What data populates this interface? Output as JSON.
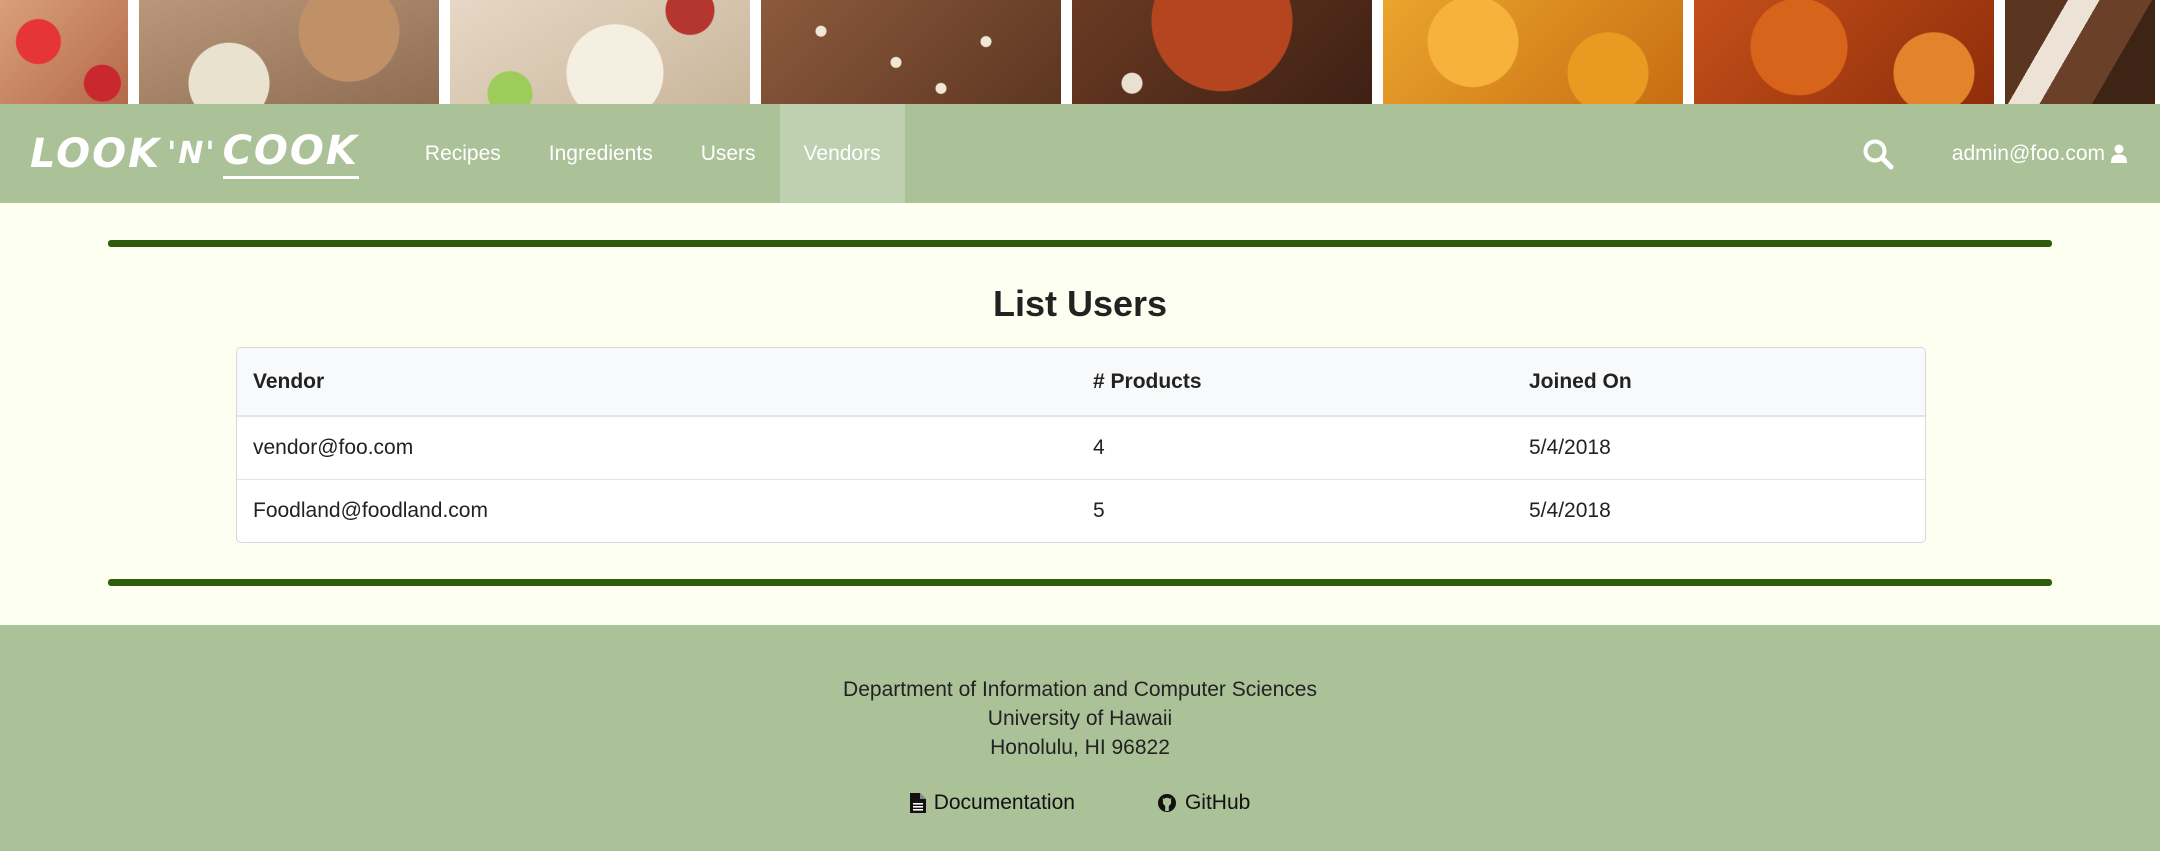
{
  "navbar": {
    "logo": {
      "part1": "LOOK",
      "amp": "'N'",
      "part2": "COOK"
    },
    "links": [
      {
        "label": "Recipes",
        "active": false
      },
      {
        "label": "Ingredients",
        "active": false
      },
      {
        "label": "Users",
        "active": false
      },
      {
        "label": "Vendors",
        "active": true
      }
    ],
    "search_icon": "search-icon",
    "user": {
      "email": "admin@foo.com",
      "icon": "user-icon"
    }
  },
  "main": {
    "title": "List Users",
    "table": {
      "headers": [
        "Vendor",
        "# Products",
        "Joined On"
      ],
      "rows": [
        [
          "vendor@foo.com",
          "4",
          "5/4/2018"
        ],
        [
          "Foodland@foodland.com",
          "5",
          "5/4/2018"
        ]
      ]
    }
  },
  "footer": {
    "address_lines": [
      "Department of Information and Computer Sciences",
      "University of Hawaii",
      "Honolulu, HI 96822"
    ],
    "links": [
      {
        "label": "Documentation",
        "icon": "file-icon"
      },
      {
        "label": "GitHub",
        "icon": "github-icon"
      }
    ]
  },
  "colors": {
    "navbar_bg": "#abc298",
    "active_nav_bg": "#bfd0b0",
    "page_bg": "#fdfff0",
    "rule": "#2f5c0c"
  }
}
